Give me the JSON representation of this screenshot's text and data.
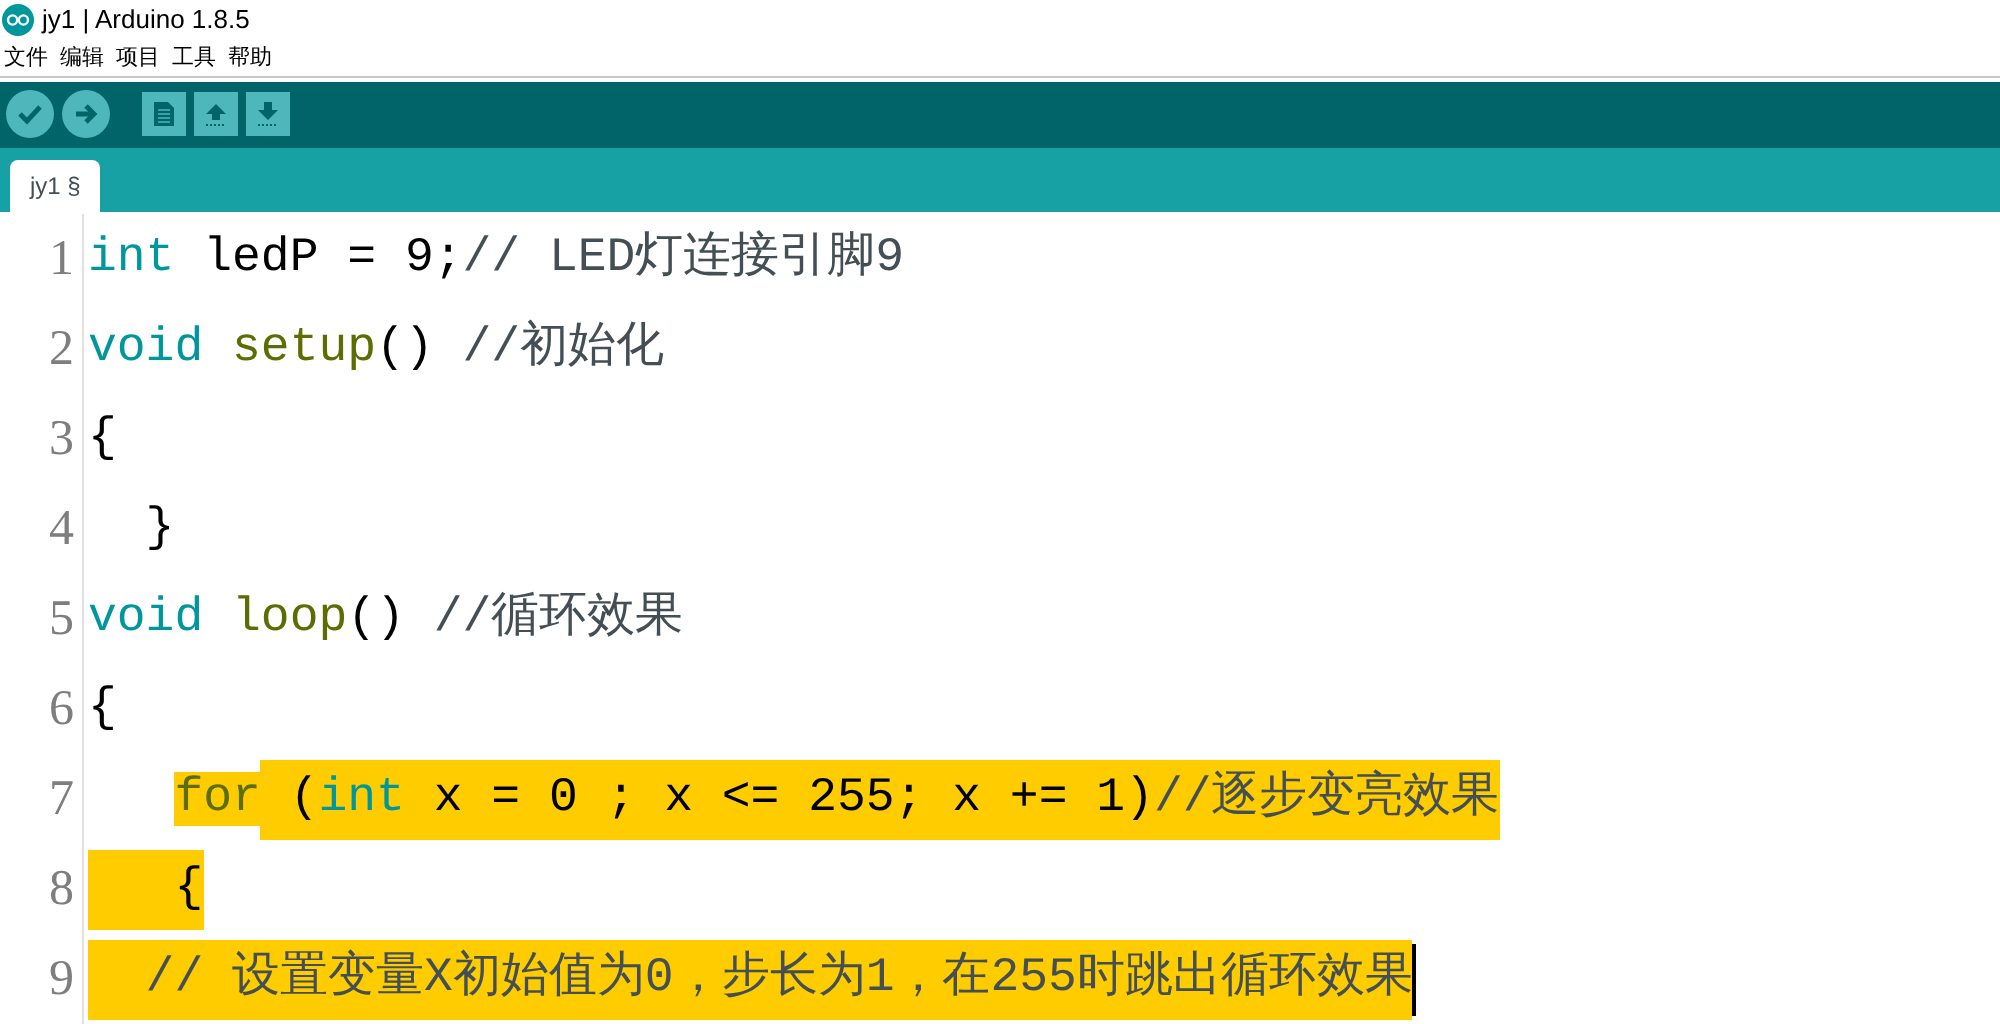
{
  "window": {
    "title": "jy1 | Arduino 1.8.5"
  },
  "menu": [
    "文件",
    "编辑",
    "项目",
    "工具",
    "帮助"
  ],
  "toolbar": [
    {
      "kind": "verify"
    },
    {
      "kind": "upload"
    },
    {
      "kind": "new"
    },
    {
      "kind": "open"
    },
    {
      "kind": "save"
    }
  ],
  "tabs": [
    {
      "label": "jy1 §",
      "selected": true
    }
  ],
  "editor": {
    "lines": [
      {
        "number": "1",
        "tokens": [
          {
            "kind": "keyword",
            "text": "int"
          },
          {
            "kind": "plain",
            "text": " ledP = 9;"
          },
          {
            "kind": "comment",
            "text": "// LED灯连接引脚9"
          }
        ]
      },
      {
        "number": "2",
        "tokens": [
          {
            "kind": "keyword",
            "text": "void"
          },
          {
            "kind": "function",
            "text": " setup"
          },
          {
            "kind": "plain",
            "text": "() "
          },
          {
            "kind": "comment",
            "text": "//初始化"
          }
        ]
      },
      {
        "number": "3",
        "tokens": [
          {
            "kind": "plain",
            "text": "{"
          }
        ]
      },
      {
        "number": "4",
        "tokens": [
          {
            "kind": "plain",
            "text": "  }"
          }
        ]
      },
      {
        "number": "5",
        "tokens": [
          {
            "kind": "keyword",
            "text": "void"
          },
          {
            "kind": "function",
            "text": " loop"
          },
          {
            "kind": "plain",
            "text": "() "
          },
          {
            "kind": "comment",
            "text": "//循环效果"
          }
        ]
      },
      {
        "number": "6",
        "tokens": [
          {
            "kind": "plain",
            "text": "{"
          }
        ]
      },
      {
        "number": "7",
        "selected_indent": false,
        "tokens": [
          {
            "kind": "function",
            "text": "   for",
            "selected": true
          },
          {
            "kind": "plain",
            "text": " (",
            "selected": true
          },
          {
            "kind": "keyword",
            "text": "int",
            "selected": true
          },
          {
            "kind": "plain",
            "text": " x = 0 ; x <= 255; x += 1)",
            "selected": true
          },
          {
            "kind": "comment",
            "text": "//逐步变亮效果",
            "selected": true
          }
        ]
      },
      {
        "number": "8",
        "selected_indent": true,
        "tokens": [
          {
            "kind": "plain",
            "text": "   {",
            "selected": true
          }
        ]
      },
      {
        "number": "9",
        "selected_indent": true,
        "caret": true,
        "tokens": [
          {
            "kind": "comment",
            "text": "  // 设置变量X初始值为0，步长为1，在255时跳出循环效果",
            "selected": true
          }
        ]
      }
    ]
  }
}
